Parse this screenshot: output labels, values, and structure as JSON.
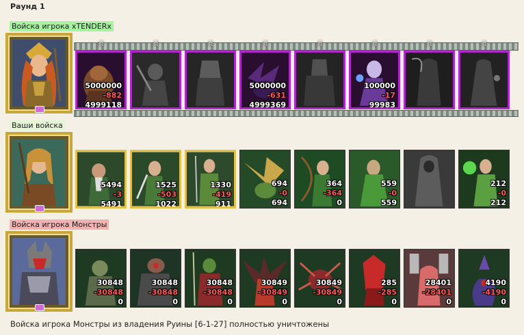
{
  "round_title": "Раунд 1",
  "footer_text": "Войска игрока Монстры из владения Руины [6-1-27] полностью уничтожены",
  "colors": {
    "enemy_label_bg": "#a6f2a0",
    "mine_label_bg": "#e6f5d8",
    "monster_label_bg": "#f3b2b2",
    "loss_text": "#ff5a5a",
    "enemy_frame": "#b026c9",
    "gold_frame": "#e2c14a"
  },
  "armies": [
    {
      "label": "Войска игрока xTENDERx",
      "portrait_icon": "valkyrie-hero-portrait",
      "units": [
        {
          "icon": "beast-unit",
          "count": "5000000",
          "loss": "-882",
          "left": "4999118"
        },
        {
          "icon": "dark-knight-unit",
          "count": "",
          "loss": "",
          "left": ""
        },
        {
          "icon": "black-knight-unit",
          "count": "",
          "loss": "",
          "left": ""
        },
        {
          "icon": "purple-dragon-unit",
          "count": "5000000",
          "loss": "-631",
          "left": "4999369"
        },
        {
          "icon": "armored-knight-unit",
          "count": "",
          "loss": "",
          "left": ""
        },
        {
          "icon": "lich-queen-unit",
          "count": "100000",
          "loss": "-17",
          "left": "99983"
        },
        {
          "icon": "reaper-unit",
          "count": "",
          "loss": "",
          "left": ""
        },
        {
          "icon": "hooded-mage-unit",
          "count": "",
          "loss": "",
          "left": ""
        }
      ]
    },
    {
      "label": "Ваши войска",
      "portrait_icon": "elf-ranger-hero-portrait",
      "units": [
        {
          "icon": "dwarf-warrior-unit",
          "count": "5494",
          "loss": "-3",
          "left": "5491"
        },
        {
          "icon": "elf-swordsman-unit",
          "count": "1525",
          "loss": "-503",
          "left": "1022"
        },
        {
          "icon": "elf-guard-unit",
          "count": "1330",
          "loss": "-419",
          "left": "911"
        },
        {
          "icon": "griffin-unit",
          "count": "694",
          "loss": "-0",
          "left": "694"
        },
        {
          "icon": "elf-archer-unit",
          "count": "364",
          "loss": "-364",
          "left": "0"
        },
        {
          "icon": "druid-unit",
          "count": "559",
          "loss": "-0",
          "left": "559"
        },
        {
          "icon": "hooded-monk-unit",
          "count": "",
          "loss": "",
          "left": ""
        },
        {
          "icon": "green-mage-unit",
          "count": "212",
          "loss": "-0",
          "left": "212"
        }
      ]
    },
    {
      "label": "Войска игрока Монстры",
      "portrait_icon": "werewolf-hero-portrait",
      "units": [
        {
          "icon": "troll-unit",
          "count": "30848",
          "loss": "-30848",
          "left": "0"
        },
        {
          "icon": "ogre-brute-unit",
          "count": "30848",
          "loss": "-30848",
          "left": "0"
        },
        {
          "icon": "orc-spearman-unit",
          "count": "30848",
          "loss": "-30848",
          "left": "0"
        },
        {
          "icon": "red-demon-unit",
          "count": "30849",
          "loss": "-30849",
          "left": "0"
        },
        {
          "icon": "spider-demon-unit",
          "count": "30849",
          "loss": "-30849",
          "left": "0"
        },
        {
          "icon": "red-imp-unit",
          "count": "285",
          "loss": "-285",
          "left": "0"
        },
        {
          "icon": "tomb-ghost-unit",
          "count": "28401",
          "loss": "-28401",
          "left": "0"
        },
        {
          "icon": "serpent-demon-unit",
          "count": "4190",
          "loss": "-4190",
          "left": "0"
        }
      ]
    }
  ]
}
